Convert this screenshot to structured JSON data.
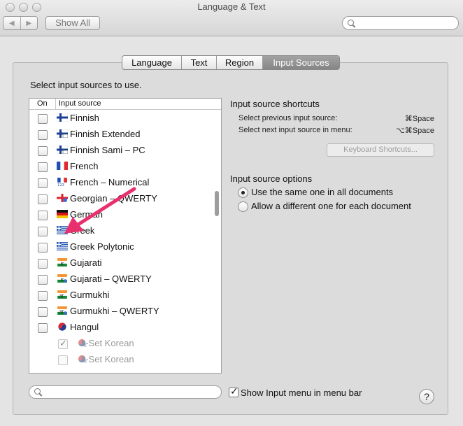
{
  "window": {
    "title": "Language & Text"
  },
  "toolbar": {
    "back_glyph": "◀",
    "forward_glyph": "▶",
    "show_all_label": "Show All",
    "search_placeholder": ""
  },
  "tabs": [
    {
      "label": "Language",
      "active": false
    },
    {
      "label": "Text",
      "active": false
    },
    {
      "label": "Region",
      "active": false
    },
    {
      "label": "Input Sources",
      "active": true
    }
  ],
  "intro": "Select input sources to use.",
  "list": {
    "col_on": "On",
    "col_source": "Input source",
    "rows": [
      {
        "label": "Finnish",
        "checked": false,
        "flag": "fi"
      },
      {
        "label": "Finnish Extended",
        "checked": false,
        "flag": "fi-ext"
      },
      {
        "label": "Finnish Sami – PC",
        "checked": false,
        "flag": "fi-sami"
      },
      {
        "label": "French",
        "checked": false,
        "flag": "fr"
      },
      {
        "label": "French – Numerical",
        "checked": false,
        "flag": "fr-num"
      },
      {
        "label": "Georgian – QWERTY",
        "checked": false,
        "flag": "ge"
      },
      {
        "label": "German",
        "checked": false,
        "flag": "de"
      },
      {
        "label": "Greek",
        "checked": false,
        "flag": "gr"
      },
      {
        "label": "Greek Polytonic",
        "checked": false,
        "flag": "gr-poly"
      },
      {
        "label": "Gujarati",
        "checked": false,
        "flag": "gu"
      },
      {
        "label": "Gujarati – QWERTY",
        "checked": false,
        "flag": "gu-q"
      },
      {
        "label": "Gurmukhi",
        "checked": false,
        "flag": "pa"
      },
      {
        "label": "Gurmukhi – QWERTY",
        "checked": false,
        "flag": "pa-q"
      },
      {
        "label": "Hangul",
        "checked": false,
        "flag": "kr"
      },
      {
        "label": "2-Set Korean",
        "checked": true,
        "flag": "kr-2",
        "sub": true
      },
      {
        "label": "3-Set Korean",
        "checked": false,
        "flag": "kr-3",
        "sub": true
      }
    ]
  },
  "shortcuts": {
    "title": "Input source shortcuts",
    "items": [
      {
        "label": "Select previous input source:",
        "key": "⌘Space"
      },
      {
        "label": "Select next input source in menu:",
        "key": "⌥⌘Space"
      }
    ],
    "button": "Keyboard Shortcuts..."
  },
  "options": {
    "title": "Input source options",
    "choices": [
      {
        "label": "Use the same one in all documents",
        "selected": true
      },
      {
        "label": "Allow a different one for each document",
        "selected": false
      }
    ]
  },
  "bottom": {
    "show_menu_label": "Show Input menu in menu bar",
    "show_menu_checked": true,
    "help_label": "?"
  },
  "colors": {
    "annotation_arrow": "#e8306f",
    "active_tab": "#8f8f8f"
  },
  "icons": [
    "close-icon",
    "minimize-icon",
    "zoom-icon",
    "search-icon",
    "help-icon",
    "arrow-annotation"
  ]
}
